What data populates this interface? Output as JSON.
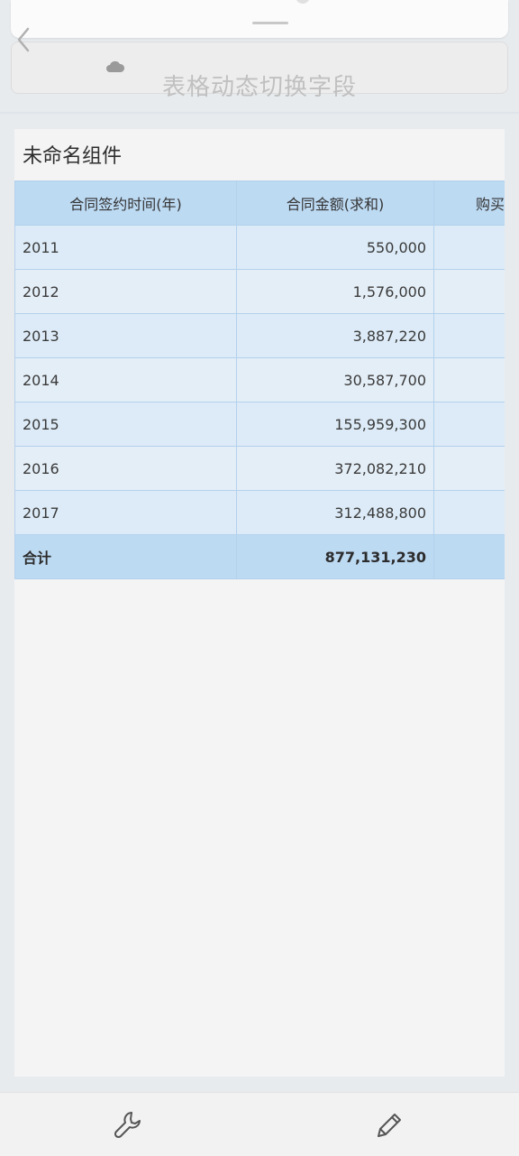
{
  "header": {
    "title": "表格动态切换字段",
    "back_icon": "chevron-left-icon",
    "cloud_icon": "cloud-icon"
  },
  "widget": {
    "title": "未命名组件",
    "columns": [
      "合同签约时间(年)",
      "合同金额(求和)",
      "购买"
    ],
    "rows": [
      {
        "year": "2011",
        "amount": "550,000"
      },
      {
        "year": "2012",
        "amount": "1,576,000"
      },
      {
        "year": "2013",
        "amount": "3,887,220"
      },
      {
        "year": "2014",
        "amount": "30,587,700"
      },
      {
        "year": "2015",
        "amount": "155,959,300"
      },
      {
        "year": "2016",
        "amount": "372,082,210"
      },
      {
        "year": "2017",
        "amount": "312,488,800"
      }
    ],
    "total": {
      "label": "合计",
      "amount": "877,131,230"
    }
  },
  "toolbar": {
    "left_icon": "wrench-icon",
    "right_icon": "pencil-icon"
  },
  "colors": {
    "header_cell": "#bddaf3",
    "body_cell": "#dcebf7",
    "border": "#b4d1ec"
  }
}
